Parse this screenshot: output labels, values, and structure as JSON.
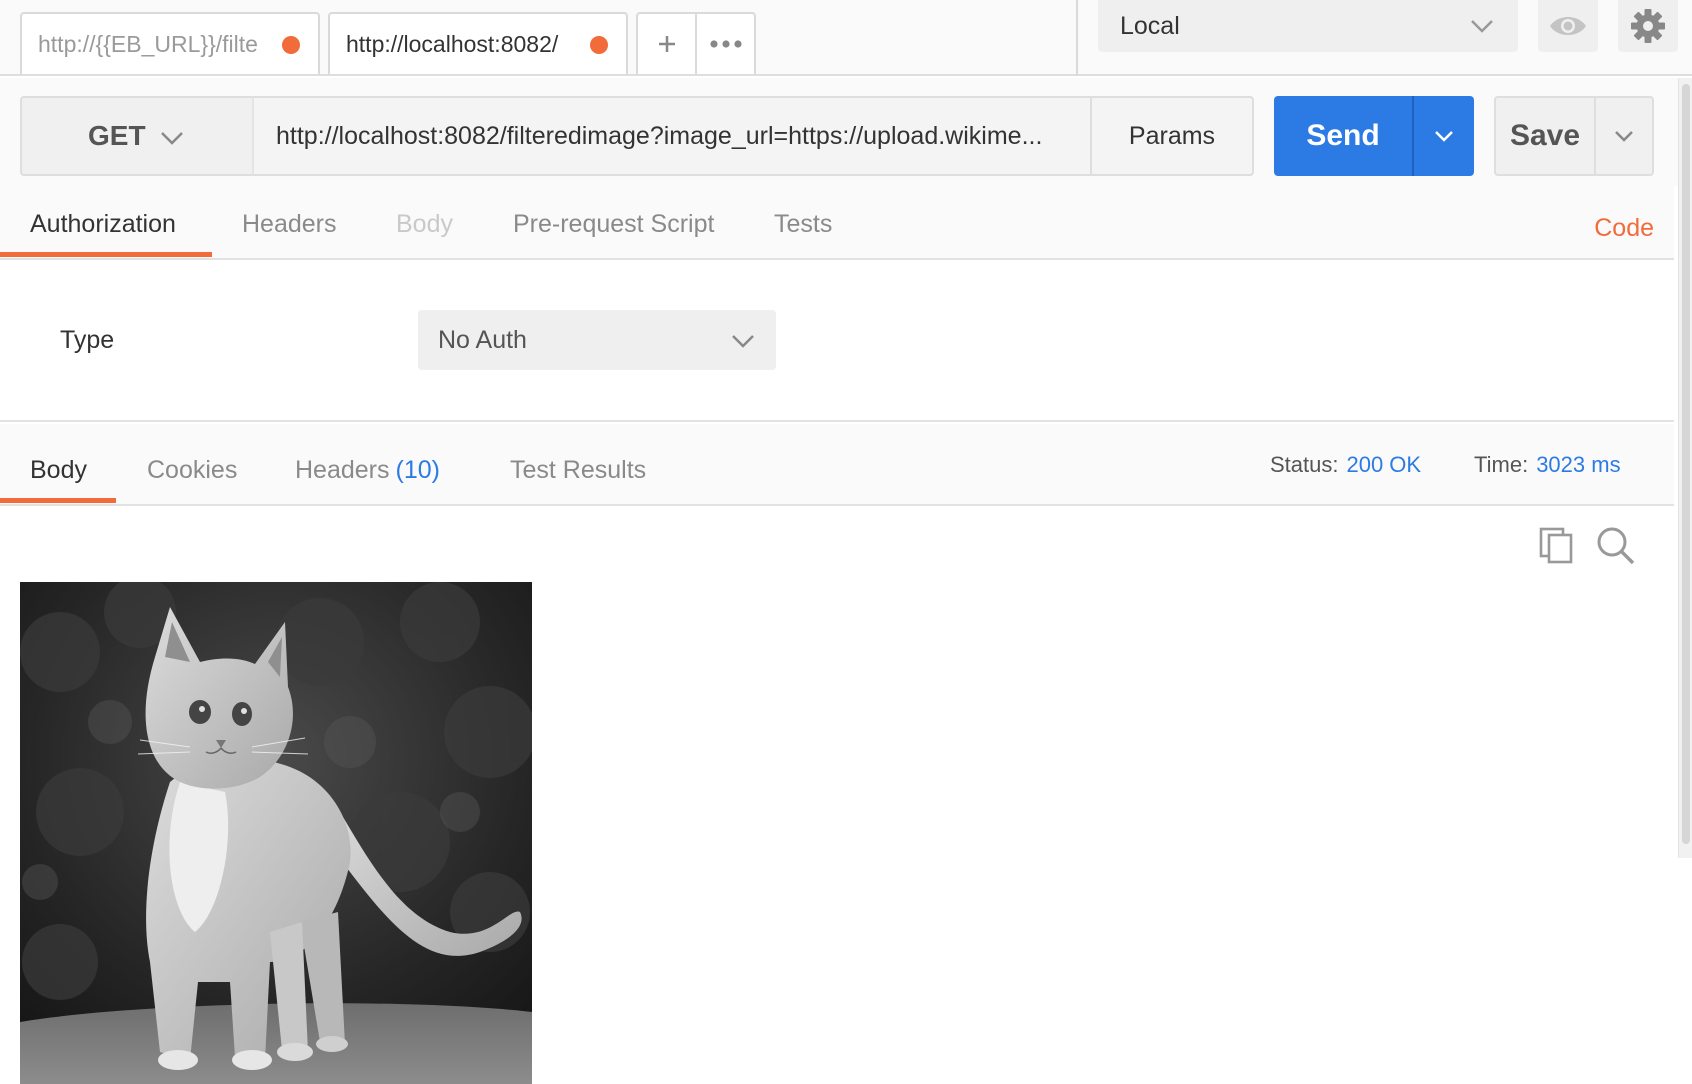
{
  "tabs": [
    {
      "label": "http://{{EB_URL}}/filte",
      "unsaved": true
    },
    {
      "label": "http://localhost:8082/",
      "unsaved": true
    }
  ],
  "tab_actions": {
    "new_tab_icon": "plus-icon",
    "more_icon": "more-dots-icon"
  },
  "environment": {
    "selected": "Local"
  },
  "request": {
    "method": "GET",
    "url": "http://localhost:8082/filteredimage?image_url=https://upload.wikime...",
    "params_label": "Params",
    "send_label": "Send",
    "save_label": "Save"
  },
  "request_tabs": [
    {
      "label": "Authorization",
      "state": "active"
    },
    {
      "label": "Headers",
      "state": "normal"
    },
    {
      "label": "Body",
      "state": "disabled"
    },
    {
      "label": "Pre-request Script",
      "state": "normal"
    },
    {
      "label": "Tests",
      "state": "normal"
    }
  ],
  "code_link": "Code",
  "auth": {
    "type_label": "Type",
    "type_value": "No Auth"
  },
  "response_tabs": [
    {
      "label": "Body",
      "state": "active"
    },
    {
      "label": "Cookies",
      "state": "normal"
    },
    {
      "label": "Headers",
      "count": "(10)",
      "state": "normal"
    },
    {
      "label": "Test Results",
      "state": "normal"
    }
  ],
  "response_meta": {
    "status_label": "Status:",
    "status_value": "200 OK",
    "time_label": "Time:",
    "time_value": "3023 ms"
  },
  "colors": {
    "accent_orange": "#f26b3a",
    "send_blue": "#2c7be5",
    "link_blue": "#2c7be5"
  },
  "icons": {
    "copy": "copy-icon",
    "search": "search-icon",
    "eye": "eye-icon",
    "gear": "gear-icon"
  }
}
